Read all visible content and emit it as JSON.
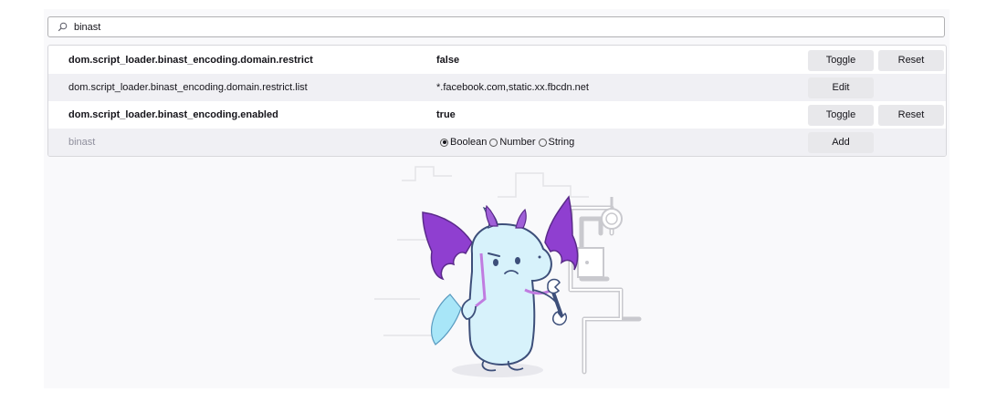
{
  "search": {
    "value": "binast"
  },
  "prefs": [
    {
      "name": "dom.script_loader.binast_encoding.domain.restrict",
      "value": "false",
      "buttons": [
        "Toggle",
        "Reset"
      ]
    },
    {
      "name": "dom.script_loader.binast_encoding.domain.restrict.list",
      "value": "*.facebook.com,static.xx.fbcdn.net",
      "buttons": [
        "Edit"
      ]
    },
    {
      "name": "dom.script_loader.binast_encoding.enabled",
      "value": "true",
      "buttons": [
        "Toggle",
        "Reset"
      ]
    }
  ],
  "new_pref": {
    "name": "binast",
    "types": [
      "Boolean",
      "Number",
      "String"
    ],
    "selected_type": "Boolean",
    "add_label": "Add"
  },
  "illustration": {
    "icon": "dragon-with-wrench-illustration"
  },
  "colors": {
    "page_bg": "#f9f9fb",
    "alt_row": "#f0f0f4",
    "button": "#e8e8eb",
    "dragon_wing": "#8f3fd0",
    "dragon_body": "#d7f2fb"
  }
}
